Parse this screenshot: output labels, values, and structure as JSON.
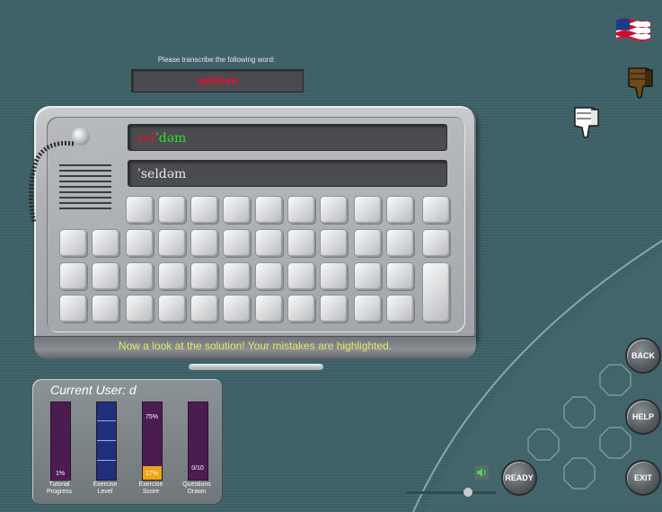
{
  "prompt": {
    "label": "Please transcribe the following word:",
    "word": "seldom"
  },
  "displays": {
    "solution_error": "sel",
    "solution_correct": "ˈdəm",
    "user_answer": "ˈseldəm"
  },
  "status_message": "Now a look at the solution! Your mistakes are highlighted.",
  "user_panel": {
    "title": "Current User: d",
    "bars": [
      {
        "label": "Tutorial Progress",
        "value_text": "1%",
        "fraction": 0.01,
        "color": "#6b1f70"
      },
      {
        "label": "Exercise Level",
        "value_text": "",
        "fraction": 1.0,
        "color": "#1f2f7a"
      },
      {
        "label": "Exercise Score",
        "value_text": "17%",
        "top_text": "75%",
        "fraction": 0.17,
        "color": "#f0a418"
      },
      {
        "label": "Questions Drawn",
        "value_text": "0/10",
        "fraction": 0.0,
        "color": "#6b1f70"
      }
    ]
  },
  "buttons": {
    "back": "BACK",
    "help": "HELP",
    "exit": "EXIT",
    "ready": "READY"
  },
  "icons": {
    "flag": "us-flag-icon",
    "thumbs_down": "thumbs-down-icon",
    "thumbs_up": "thumbs-up-icon",
    "volume": "speaker-icon"
  },
  "colors": {
    "error": "#e0142a",
    "correct": "#2ee02e",
    "status": "#e8e46a"
  }
}
